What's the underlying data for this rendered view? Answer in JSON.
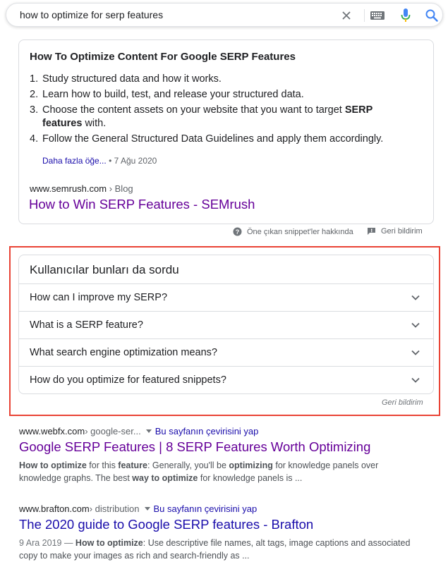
{
  "search": {
    "query": "how to optimize for serp features",
    "icons": [
      "close-icon",
      "keyboard-icon",
      "microphone-icon",
      "search-icon"
    ]
  },
  "snippet": {
    "title": "How To Optimize Content For Google SERP Features",
    "steps": [
      {
        "num": "1.",
        "pre": "Study structured data and how it works.",
        "bold": "",
        "post": ""
      },
      {
        "num": "2.",
        "pre": "Learn how to build, test, and release your structured data.",
        "bold": "",
        "post": ""
      },
      {
        "num": "3.",
        "pre": "Choose the content assets on your website that you want to target ",
        "bold": "SERP features",
        "post": " with."
      },
      {
        "num": "4.",
        "pre": "Follow the General Structured Data Guidelines and apply them accordingly.",
        "bold": "",
        "post": ""
      }
    ],
    "more_link": "Daha fazla öğe...",
    "date": "• 7 Ağu 2020",
    "url_domain": "www.semrush.com",
    "url_crumb": " › Blog",
    "link_title": "How to Win SERP Features - SEMrush"
  },
  "snippet_footer": {
    "about": "Öne çıkan snippet'ler hakkında",
    "feedback": "Geri bildirim"
  },
  "paa": {
    "title": "Kullanıcılar bunları da sordu",
    "questions": [
      "How can I improve my SERP?",
      "What is a SERP feature?",
      "What search engine optimization means?",
      "How do you optimize for featured snippets?"
    ],
    "feedback": "Geri bildirim",
    "highlight_color": "#e94335"
  },
  "results": [
    {
      "domain": "www.webfx.com",
      "crumb": " › google-ser...",
      "translate": "Bu sayfanın çevirisini yap",
      "title": "Google SERP Features | 8 SERP Features Worth Optimizing",
      "visited": true,
      "desc_html": "<b>How to optimize</b> for this <b>feature</b>: Generally, you'll be <b>optimizing</b> for knowledge panels over knowledge graphs. The best <b>way to optimize</b> for knowledge panels is ..."
    },
    {
      "domain": "www.brafton.com",
      "crumb": " › distribution",
      "translate": "Bu sayfanın çevirisini yap",
      "title": "The 2020 guide to Google SERP features - Brafton",
      "visited": false,
      "desc_html": "<span style=\"color:#70757a\">9 Ara 2019 — </span><b>How to optimize</b>: Use descriptive file names, alt tags, image captions and associated copy to make your images as rich and search-friendly as ..."
    }
  ],
  "colors": {
    "link_unvisited": "#1a0dab",
    "link_visited": "#660099",
    "border": "#dadce0",
    "highlight": "#e94335"
  }
}
